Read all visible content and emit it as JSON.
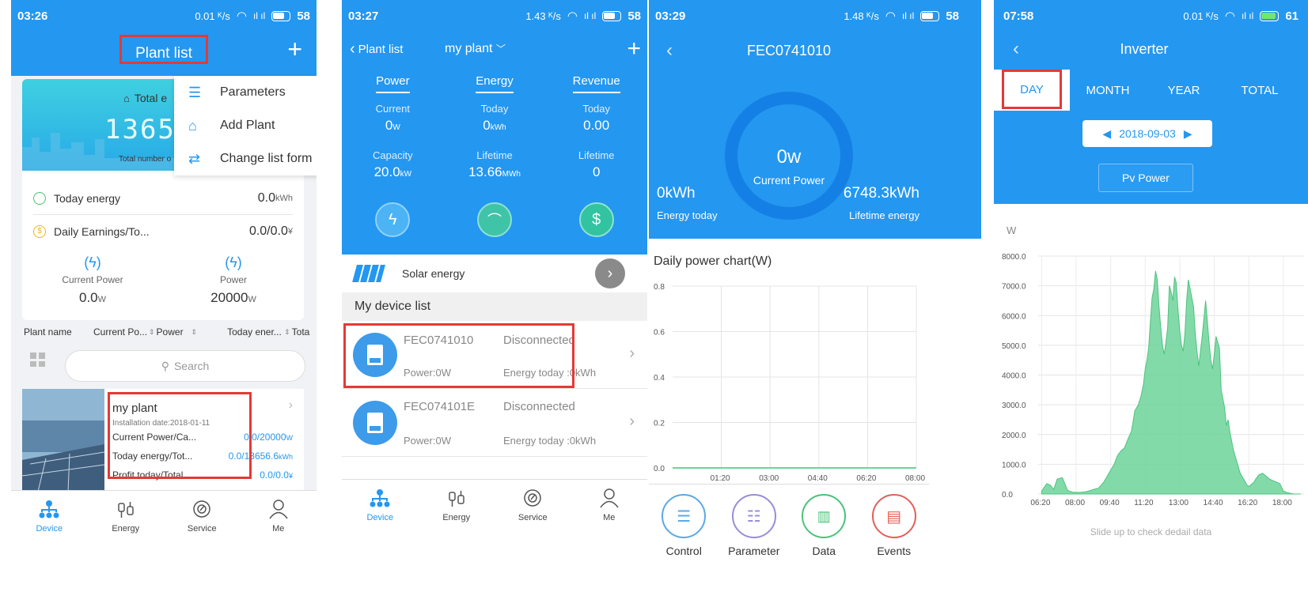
{
  "screen1": {
    "status": {
      "time": "03:26",
      "net": "0.01 ᴷ/s",
      "battery": "58"
    },
    "title": "Plant list",
    "add_symbol": "+",
    "banner": {
      "total_label": "Total e",
      "big_number": "13658",
      "sub_label": "Total number o"
    },
    "menu": [
      {
        "label": "Parameters",
        "icon": "list-icon"
      },
      {
        "label": "Add Plant",
        "icon": "home-add-icon"
      },
      {
        "label": "Change list form",
        "icon": "swap-icon"
      }
    ],
    "today_energy": {
      "label": "Today energy",
      "value": "0.0",
      "unit": "kWh"
    },
    "daily_earnings": {
      "label": "Daily Earnings/To...",
      "value": "0.0/0.0",
      "unit": "¥"
    },
    "current_power": {
      "label": "Current Power",
      "value": "0.0",
      "unit": "W"
    },
    "power": {
      "label": "Power",
      "value": "20000",
      "unit": "W"
    },
    "sort": {
      "plant_name": "Plant name",
      "current_po": "Current Po...",
      "power": "Power",
      "today_ener": "Today ener...",
      "tota": "Tota"
    },
    "search_placeholder": "Search",
    "plant": {
      "name": "my plant",
      "install": "Installation date:2018-01-11",
      "row1_label": "Current Power/Ca...",
      "row1_value": "0.0/20000",
      "row1_unit": "W",
      "row2_label": "Today energy/Tot...",
      "row2_value": "0.0/13656.6",
      "row2_unit": "kWh",
      "row3_label": "Profit today/Total",
      "row3_value": "0.0/0.0",
      "row3_unit": "¥"
    },
    "tabs": [
      "Device",
      "Energy",
      "Service",
      "Me"
    ]
  },
  "screen2": {
    "status": {
      "time": "03:27",
      "net": "1.43 ᴷ/s",
      "battery": "58"
    },
    "back_label": "Plant list",
    "title": "my plant",
    "add_symbol": "+",
    "columns": [
      {
        "head": "Power",
        "l1": "Current",
        "v1": "0",
        "u1": "W",
        "l2": "Capacity",
        "v2": "20.0",
        "u2": "kW"
      },
      {
        "head": "Energy",
        "l1": "Today",
        "v1": "0",
        "u1": "kWh",
        "l2": "Lifetime",
        "v2": "13.66",
        "u2": "MWh"
      },
      {
        "head": "Revenue",
        "l1": "Today",
        "v1": "0.00",
        "u1": "",
        "l2": "Lifetime",
        "v2": "0",
        "u2": ""
      }
    ],
    "solar_label": "Solar energy",
    "device_list_label": "My device list",
    "devices": [
      {
        "sn": "FEC0741010",
        "status": "Disconnected",
        "power": "Power:0W",
        "energy": "Energy today :0kWh"
      },
      {
        "sn": "FEC074101E",
        "status": "Disconnected",
        "power": "Power:0W",
        "energy": "Energy today :0kWh"
      }
    ],
    "tabs": [
      "Device",
      "Energy",
      "Service",
      "Me"
    ]
  },
  "screen3": {
    "status": {
      "time": "03:29",
      "net": "1.48 ᴷ/s",
      "battery": "58"
    },
    "title": "FEC0741010",
    "ring_value": "0w",
    "ring_label": "Current Power",
    "energy_today_value": "0kWh",
    "energy_today_label": "Energy today",
    "lifetime_value": "6748.3kWh",
    "lifetime_label": "Lifetime energy",
    "chart_title": "Daily power chart(W)",
    "y_ticks": [
      "0.8",
      "0.6",
      "0.4",
      "0.2",
      "0.0"
    ],
    "x_ticks": [
      "01:20",
      "03:00",
      "04:40",
      "06:20",
      "08:00"
    ],
    "actions": [
      "Control",
      "Parameter",
      "Data",
      "Events"
    ]
  },
  "screen4": {
    "status": {
      "time": "07:58",
      "net": "0.01 ᴷ/s",
      "battery": "61"
    },
    "title": "Inverter",
    "periods": [
      "DAY",
      "MONTH",
      "YEAR",
      "TOTAL"
    ],
    "date": "2018-09-03",
    "pv_button": "Pv Power",
    "y_unit": "W",
    "footer": "Slide up to check dedail data"
  },
  "chart_data": [
    {
      "type": "line",
      "title": "Daily power chart(W)",
      "x": [
        "01:20",
        "03:00",
        "04:40",
        "06:20",
        "08:00"
      ],
      "series": [
        {
          "values": [
            0,
            0,
            0,
            0,
            0
          ]
        }
      ],
      "ylim": [
        0,
        0.8
      ],
      "y_ticks": [
        0.0,
        0.2,
        0.4,
        0.6,
        0.8
      ],
      "grid": true,
      "color": "#6dd39a"
    },
    {
      "type": "area",
      "ylabel": "W",
      "x_ticks": [
        "06:20",
        "08:00",
        "09:40",
        "11:20",
        "13:00",
        "14:40",
        "16:20",
        "18:00"
      ],
      "y_ticks": [
        0.0,
        1000.0,
        2000.0,
        3000.0,
        4000.0,
        5000.0,
        6000.0,
        7000.0,
        8000.0
      ],
      "ylim": [
        0,
        8000
      ],
      "x_minutes": [
        380,
        395,
        405,
        415,
        425,
        440,
        455,
        470,
        490,
        510,
        530,
        545,
        560,
        575,
        590,
        600,
        610,
        620,
        630,
        640,
        650,
        660,
        668,
        675,
        680,
        685,
        690,
        695,
        700,
        705,
        710,
        715,
        720,
        725,
        730,
        735,
        740,
        745,
        750,
        755,
        760,
        765,
        770,
        775,
        780,
        785,
        790,
        795,
        800,
        805,
        810,
        815,
        820,
        825,
        830,
        835,
        840,
        845,
        850,
        855,
        860,
        865,
        870,
        875,
        880,
        885,
        890,
        895,
        900,
        905,
        910,
        915,
        920,
        925,
        930,
        935,
        940,
        945,
        950,
        955,
        960,
        965,
        970,
        975,
        980,
        985,
        990,
        995,
        1000,
        1010,
        1020,
        1030,
        1040,
        1050,
        1060,
        1070,
        1080,
        1090,
        1100,
        1110,
        1120,
        1130
      ],
      "values": [
        100,
        350,
        300,
        150,
        500,
        550,
        120,
        60,
        50,
        80,
        150,
        200,
        400,
        700,
        1000,
        1300,
        1450,
        1550,
        1850,
        2100,
        2800,
        3000,
        3300,
        3700,
        4200,
        4500,
        4900,
        5800,
        6600,
        6900,
        7500,
        7200,
        6300,
        5600,
        5000,
        4700,
        5100,
        5600,
        7000,
        6800,
        6500,
        7300,
        7100,
        6200,
        5500,
        5000,
        4800,
        5400,
        6500,
        7200,
        6900,
        6600,
        6300,
        5400,
        4800,
        4300,
        4800,
        5300,
        5900,
        6500,
        5800,
        5100,
        4500,
        4200,
        4700,
        5300,
        5100,
        4900,
        3500,
        3200,
        2900,
        2300,
        2500,
        2100,
        1800,
        1500,
        1300,
        1100,
        900,
        700,
        600,
        500,
        400,
        300,
        250,
        300,
        350,
        400,
        500,
        650,
        700,
        600,
        500,
        450,
        400,
        350,
        100,
        50,
        20,
        0,
        0,
        0
      ],
      "color": "#6dd39a"
    }
  ]
}
